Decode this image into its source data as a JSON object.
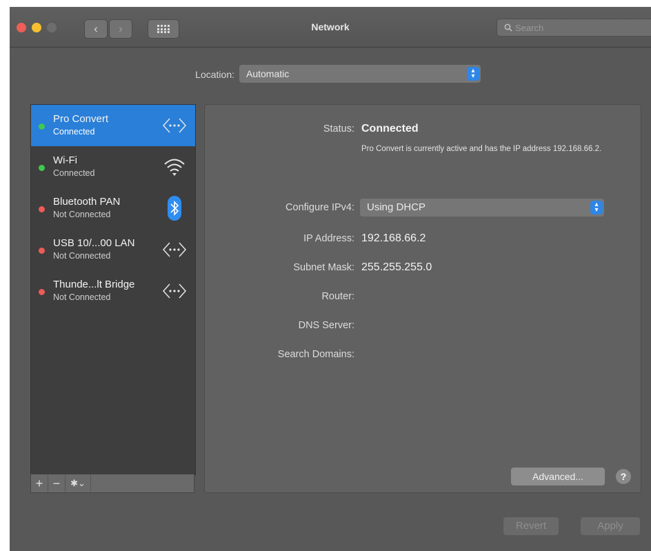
{
  "window": {
    "title": "Network",
    "search": {
      "placeholder": "Search",
      "icon": "magnifier"
    },
    "traffic_lights": {
      "close": "#ed5f56",
      "minimize": "#f5bf2f",
      "zoom": "#6d6d6d"
    },
    "nav": {
      "back": "‹",
      "forward": "›",
      "grid": "⠿"
    }
  },
  "location": {
    "label": "Location:",
    "value": "Automatic"
  },
  "services": [
    {
      "name": "Pro Convert",
      "status": "Connected",
      "dot_color": "#3fc950",
      "icon": "ethernet-arrows-icon",
      "selected": true
    },
    {
      "name": "Wi-Fi",
      "status": "Connected",
      "dot_color": "#3fc950",
      "icon": "wifi-icon",
      "selected": false
    },
    {
      "name": "Bluetooth PAN",
      "status": "Not Connected",
      "dot_color": "#ef5b55",
      "icon": "bluetooth-icon",
      "selected": false
    },
    {
      "name": "USB 10/...00 LAN",
      "status": "Not Connected",
      "dot_color": "#ef5b55",
      "icon": "ethernet-arrows-icon",
      "selected": false
    },
    {
      "name": "Thunde...lt Bridge",
      "status": "Not Connected",
      "dot_color": "#ef5b55",
      "icon": "ethernet-arrows-icon",
      "selected": false
    }
  ],
  "sidebar_toolbar": {
    "add": "+",
    "remove": "−",
    "action": "✱⌄"
  },
  "details": {
    "status_label": "Status:",
    "status_value": "Connected",
    "status_description": "Pro Convert is currently active and has the IP address 192.168.66.2.",
    "configure_label": "Configure IPv4:",
    "configure_value": "Using DHCP",
    "ip_label": "IP Address:",
    "ip_value": "192.168.66.2",
    "subnet_label": "Subnet Mask:",
    "subnet_value": "255.255.255.0",
    "router_label": "Router:",
    "dns_label": "DNS Server:",
    "search_domains_label": "Search Domains:"
  },
  "buttons": {
    "advanced": "Advanced...",
    "help": "?",
    "revert": "Revert",
    "apply": "Apply"
  },
  "colors": {
    "accent": "#2a7fd8",
    "window_bg": "#585858",
    "panel_bg": "#616161"
  }
}
